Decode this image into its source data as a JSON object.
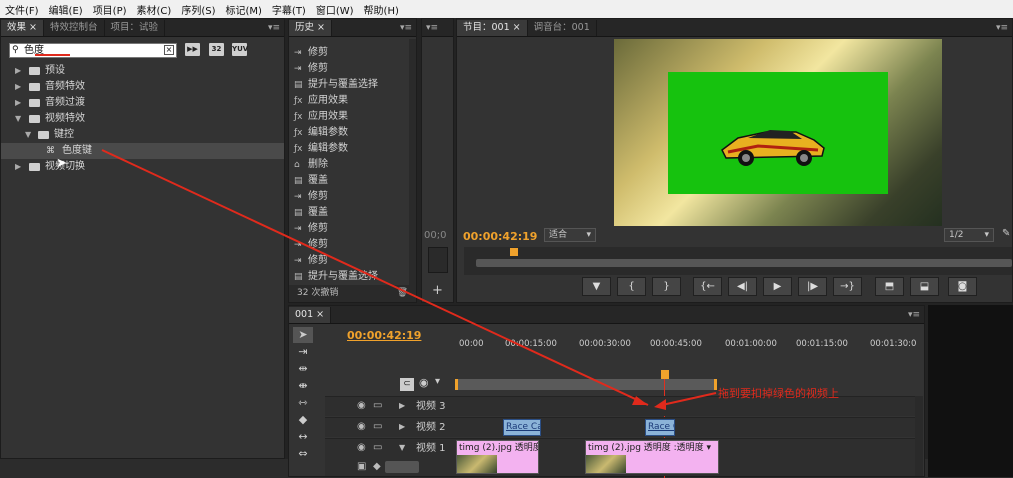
{
  "menu": [
    "文件(F)",
    "编辑(E)",
    "项目(P)",
    "素材(C)",
    "序列(S)",
    "标记(M)",
    "字幕(T)",
    "窗口(W)",
    "帮助(H)"
  ],
  "effects_panel": {
    "tabs": [
      "效果",
      "特效控制台",
      "项目：试验"
    ],
    "search_value": "色度",
    "badges": [
      "32",
      "YUV"
    ],
    "tree": [
      {
        "label": "预设",
        "expanded": false
      },
      {
        "label": "音频特效",
        "expanded": false
      },
      {
        "label": "音频过渡",
        "expanded": false
      },
      {
        "label": "视频特效",
        "expanded": true
      },
      {
        "label": "键控",
        "expanded": true
      },
      {
        "label": "色度键",
        "selected": true
      },
      {
        "label": "视频切换",
        "expanded": false
      }
    ]
  },
  "history_panel": {
    "tab": "历史",
    "items": [
      {
        "icon": "trim",
        "label": "修剪"
      },
      {
        "icon": "trim",
        "label": "修剪"
      },
      {
        "icon": "lift",
        "label": "提升与覆盖选择"
      },
      {
        "icon": "fx",
        "label": "应用效果"
      },
      {
        "icon": "fx",
        "label": "应用效果"
      },
      {
        "icon": "fx",
        "label": "编辑参数"
      },
      {
        "icon": "fx",
        "label": "编辑参数"
      },
      {
        "icon": "delete",
        "label": "删除"
      },
      {
        "icon": "overlay",
        "label": "覆盖"
      },
      {
        "icon": "trim",
        "label": "修剪"
      },
      {
        "icon": "overlay",
        "label": "覆盖"
      },
      {
        "icon": "trim",
        "label": "修剪"
      },
      {
        "icon": "trim",
        "label": "修剪"
      },
      {
        "icon": "trim",
        "label": "修剪"
      },
      {
        "icon": "lift",
        "label": "提升与覆盖选择"
      }
    ],
    "footer": "32 次撤销"
  },
  "program_monitor": {
    "tabs": [
      "节目：001",
      "调音台：001"
    ],
    "timecode": "00:00:42:19",
    "left_timecode": "00;0",
    "fit": "适合",
    "resolution": "1/2"
  },
  "timeline": {
    "tab": "001",
    "timecode": "00:00:42:19",
    "ruler": [
      "00:00",
      "00:00:15:00",
      "00:00:30:00",
      "00:00:45:00",
      "00:01:00:00",
      "00:01:15:00",
      "00:01:30:0"
    ],
    "tracks": [
      {
        "name": "视频 3"
      },
      {
        "name": "视频 2",
        "clips": [
          "Race Ca",
          "Race C"
        ]
      },
      {
        "name": "视频 1",
        "clips": [
          "timg (2).jpg 透明度 ▾",
          "timg (2).jpg 透明度 :透明度 ▾"
        ]
      }
    ]
  },
  "annotation": "拖到要扣掉绿色的视频上",
  "colors": {
    "timecode": "#f0a22c",
    "annotation": "#e02a1c",
    "chroma_green": "#16c20e"
  }
}
